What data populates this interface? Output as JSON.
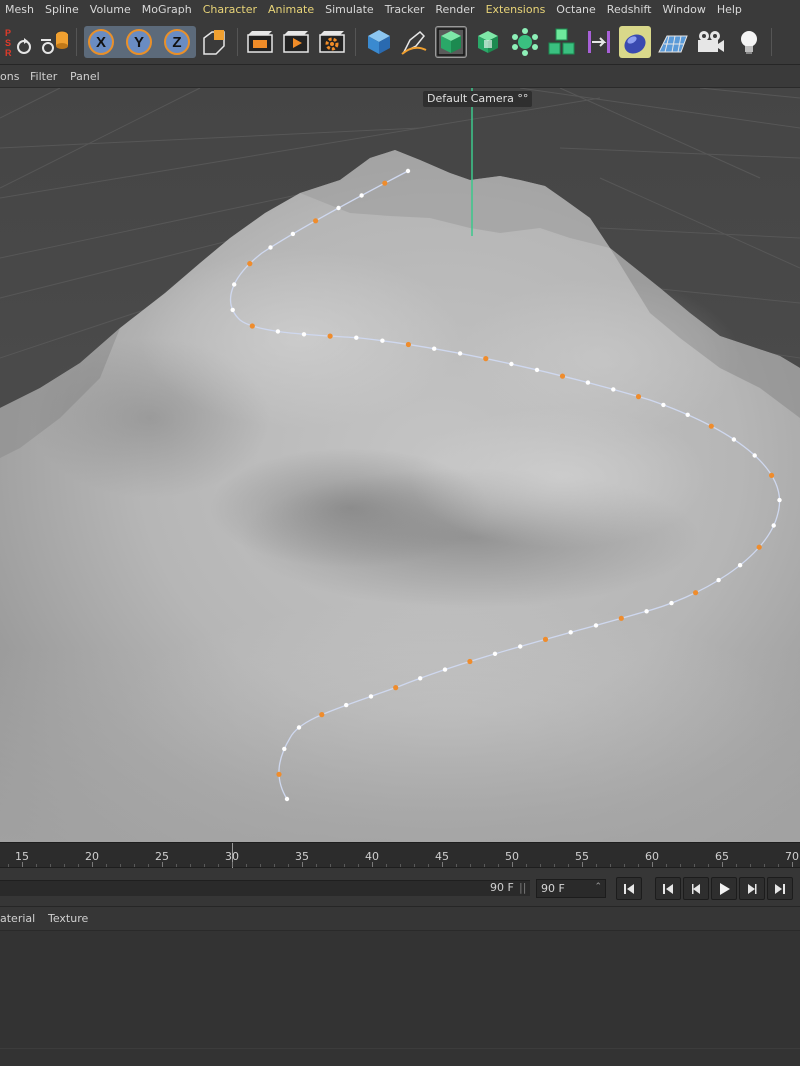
{
  "menu": [
    "Mesh",
    "Spline",
    "Volume",
    "MoGraph",
    "Character",
    "Animate",
    "Simulate",
    "Tracker",
    "Render",
    "Extensions",
    "Octane",
    "Redshift",
    "Window",
    "Help"
  ],
  "menu_highlight": [
    "Character",
    "Animate",
    "Extensions"
  ],
  "toolbar": {
    "psr_letters": "PSR",
    "axes": [
      "X",
      "Y",
      "Z"
    ],
    "icons": [
      "reset-psr-icon",
      "locked-coords-icon",
      "x-axis-icon",
      "y-axis-icon",
      "z-axis-icon",
      "coordinate-system-icon",
      "render-view-icon",
      "render-picture-viewer-icon",
      "render-settings-icon",
      "cube-icon",
      "pen-icon",
      "subdivision-surface-icon",
      "extrude-icon",
      "mograph-cloner-icon",
      "array-icon",
      "deformer-icon",
      "field-icon",
      "floor-icon",
      "camera-icon",
      "light-icon"
    ]
  },
  "viewport_menu": [
    "ons",
    "Filter",
    "Panel"
  ],
  "viewport": {
    "camera_label": "Default Camera",
    "camera_suffix": "°°"
  },
  "timeline": {
    "ticks": [
      "15",
      "20",
      "25",
      "30",
      "35",
      "40",
      "45",
      "50",
      "55",
      "60",
      "65",
      "70"
    ],
    "end_frame": "90 F",
    "frame_field": "90 F"
  },
  "transport_icons": [
    "go-to-start-icon",
    "go-to-previous-key-icon",
    "step-back-icon",
    "play-icon",
    "step-forward-icon",
    "go-to-end-icon"
  ],
  "material_menu": [
    "aterial",
    "Texture"
  ],
  "colors": {
    "menu_text": "#d8d8d8",
    "menu_highlight": "#e8d478",
    "spline_point": "#ffffff",
    "spline_tangent": "#ef8c2c",
    "y_axis": "#3cc88c"
  }
}
